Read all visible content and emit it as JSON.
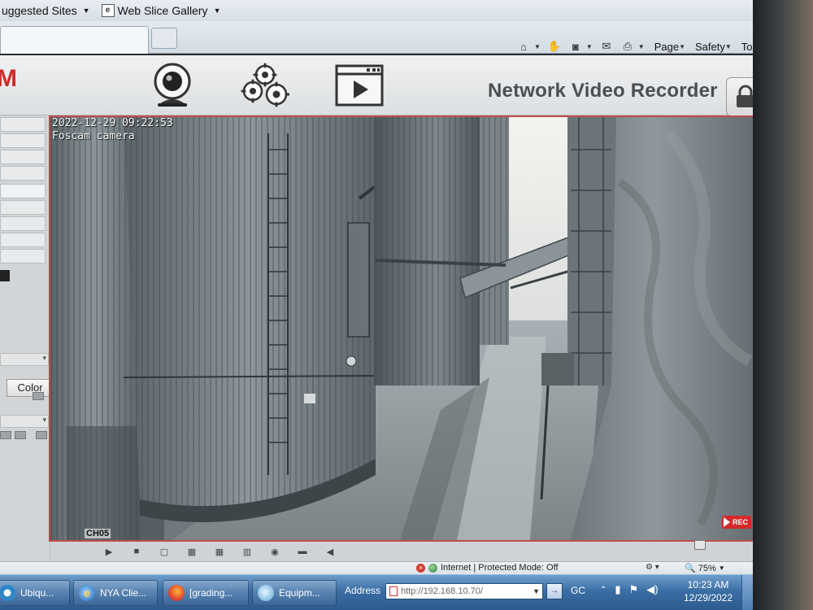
{
  "browser": {
    "favorites": [
      {
        "label": "uggested Sites"
      },
      {
        "label": "Web Slice Gallery"
      }
    ],
    "command_bar": {
      "page": "Page",
      "safety": "Safety",
      "tools": "Tools",
      "help": "?"
    },
    "status": {
      "zone": "Internet | Protected Mode: Off",
      "zoom": "75%"
    }
  },
  "app": {
    "brand": "M",
    "title": "Network Video Recorder",
    "nav": [
      "live-view",
      "settings",
      "playback"
    ],
    "side_panel": {
      "color_button": "Color"
    },
    "video": {
      "timestamp": "2022-12-29 09:22:53",
      "camera_name": "Foscam camera",
      "channel": "CH05",
      "rec_label": "REC"
    }
  },
  "taskbar": {
    "items": [
      {
        "label": "Ubiqu..."
      },
      {
        "label": "NYA Clie..."
      },
      {
        "label": "[grading..."
      },
      {
        "label": "Equipm..."
      }
    ],
    "address_label": "Address",
    "address_value": "http://192.168.10.70/",
    "tray_text": "GC",
    "clock_time": "10:23 AM",
    "clock_date": "12/29/2022"
  },
  "colors": {
    "brand_red": "#cc2b2b",
    "video_border": "#c24b4b",
    "rec_red": "#d62a2a",
    "taskbar_blue": "#3b6ea5"
  }
}
